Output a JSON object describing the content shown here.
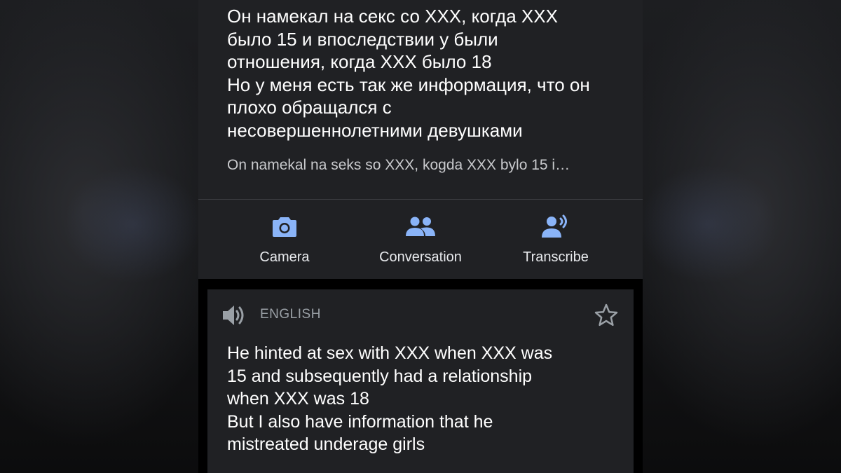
{
  "source": {
    "text": "Он намекал на секс со XXX, когда XXX\nбыло 15 и впоследствии у были\nотношения, когда XXX было 18\nНо у меня есть так же информация, что он\nплохо обращался с\nнесовершеннолетними девушками",
    "transliteration": "On namekal na seks so XXX, kogda XXX bylo 15 i…"
  },
  "actions": [
    {
      "label": "Camera",
      "icon": "camera-icon"
    },
    {
      "label": "Conversation",
      "icon": "people-icon"
    },
    {
      "label": "Transcribe",
      "icon": "transcribe-icon"
    }
  ],
  "target": {
    "language": "ENGLISH",
    "speaker_icon": "speaker-icon",
    "star_icon": "star-outline-icon",
    "text": "He hinted at sex with XXX when XXX was\n15 and subsequently had a relationship\nwhen XXX was 18\n But I also have information that he\nmistreated underage girls"
  },
  "colors": {
    "card_bg": "#202124",
    "accent_blue": "#8ab4f8",
    "icon_gray": "#9aa0a6",
    "text_primary": "#ffffff",
    "text_secondary": "#c9cacd"
  }
}
